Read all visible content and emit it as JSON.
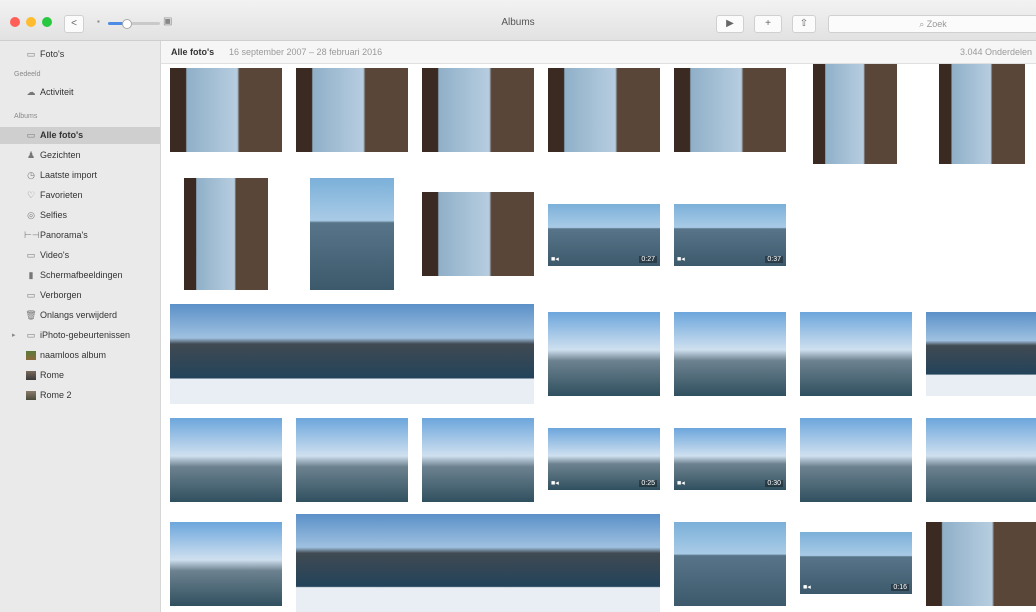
{
  "window": {
    "title": "Albums",
    "search_placeholder": "Zoek"
  },
  "toolbar": {
    "back_symbol": "<",
    "play_symbol": "▶",
    "add_symbol": "+",
    "share_symbol": "⇧"
  },
  "header": {
    "title": "Alle foto's",
    "date_range": "16 september 2007 – 28 februari 2016",
    "count": "3.044 Onderdelen"
  },
  "sidebar": {
    "items": [
      {
        "label": "Foto's",
        "icon": "photos-icon"
      },
      {
        "label": "Activiteit",
        "icon": "cloud-icon"
      },
      {
        "label": "Alle foto's",
        "icon": "photos-icon"
      },
      {
        "label": "Gezichten",
        "icon": "person-icon"
      },
      {
        "label": "Laatste import",
        "icon": "clock-icon"
      },
      {
        "label": "Favorieten",
        "icon": "heart-icon"
      },
      {
        "label": "Selfies",
        "icon": "camera-icon"
      },
      {
        "label": "Panorama's",
        "icon": "panorama-icon"
      },
      {
        "label": "Video's",
        "icon": "video-icon"
      },
      {
        "label": "Schermafbeeldingen",
        "icon": "phone-icon"
      },
      {
        "label": "Verborgen",
        "icon": "hidden-icon"
      },
      {
        "label": "Onlangs verwijderd",
        "icon": "trash-icon"
      },
      {
        "label": "iPhoto-gebeurtenissen",
        "icon": "folder-icon"
      },
      {
        "label": "naamloos album",
        "icon": "album-icon"
      },
      {
        "label": "Rome",
        "icon": "album-icon"
      },
      {
        "label": "Rome 2",
        "icon": "album-icon"
      }
    ],
    "sections": [
      "Gedeeld",
      "Albums"
    ]
  },
  "grid": {
    "videos": [
      "0:27",
      "0:37",
      "0:25",
      "0:30",
      "0:16"
    ]
  }
}
